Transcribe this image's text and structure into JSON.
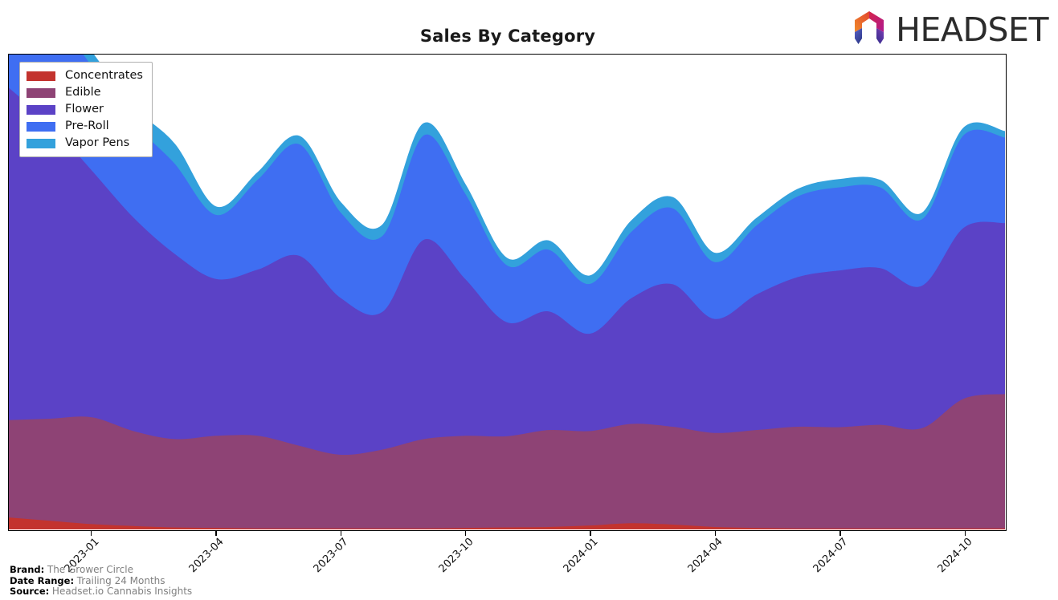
{
  "header": {
    "title": "Sales By Category",
    "logo_text": "HEADSET",
    "logo_icon": "headset-hexagon-logo"
  },
  "footer": {
    "rows": [
      {
        "key": "Brand:",
        "value": "The Grower Circle"
      },
      {
        "key": "Date Range:",
        "value": "Trailing 24 Months"
      },
      {
        "key": "Source:",
        "value": "Headset.io Cannabis Insights"
      }
    ]
  },
  "legend": {
    "position": "upper-left",
    "items": [
      {
        "label": "Concentrates",
        "color": "#C3332E"
      },
      {
        "label": "Edible",
        "color": "#8E4375"
      },
      {
        "label": "Flower",
        "color": "#5B42C6"
      },
      {
        "label": "Pre-Roll",
        "color": "#3F6EF2"
      },
      {
        "label": "Vapor Pens",
        "color": "#33A1DC"
      }
    ]
  },
  "chart_data": {
    "type": "area",
    "stacked": true,
    "title": "Sales By Category",
    "xlabel": "",
    "ylabel": "",
    "grid": false,
    "legend_position": "upper-left",
    "axis": {
      "x_tick_labels": [
        "2023-01",
        "2023-04",
        "2023-07",
        "2023-10",
        "2024-01",
        "2024-04",
        "2024-07",
        "2024-10"
      ],
      "x_tick_rotation": -45,
      "y_ticks_visible": false,
      "ylim": [
        0,
        100
      ]
    },
    "x": [
      "2022-11",
      "2022-12",
      "2023-01",
      "2023-02",
      "2023-03",
      "2023-04",
      "2023-05",
      "2023-06",
      "2023-07",
      "2023-08",
      "2023-09",
      "2023-10",
      "2023-11",
      "2023-12",
      "2024-01",
      "2024-02",
      "2024-03",
      "2024-04",
      "2024-05",
      "2024-06",
      "2024-07",
      "2024-08",
      "2024-09",
      "2024-10",
      "2024-11"
    ],
    "series": [
      {
        "name": "Concentrates",
        "color": "#C3332E",
        "values": [
          2.6,
          1.9,
          1.2,
          0.8,
          0.5,
          0.4,
          0.3,
          0.3,
          0.3,
          0.3,
          0.3,
          0.4,
          0.5,
          0.6,
          0.9,
          1.4,
          1.1,
          0.6,
          0.4,
          0.3,
          0.3,
          0.3,
          0.3,
          0.3,
          0.3
        ]
      },
      {
        "name": "Edible",
        "color": "#8E4375",
        "values": [
          20.5,
          21.5,
          22.5,
          20.0,
          18.6,
          19.4,
          19.5,
          17.4,
          15.5,
          16.6,
          18.8,
          19.4,
          19.2,
          20.4,
          19.9,
          20.9,
          20.6,
          19.8,
          20.6,
          21.4,
          21.3,
          21.8,
          21.1,
          27.3,
          28.3
        ]
      },
      {
        "name": "Flower",
        "color": "#5B42C6",
        "values": [
          70.0,
          62.0,
          52.0,
          45.0,
          39.0,
          33.0,
          35.0,
          40.0,
          33.0,
          29.0,
          42.0,
          33.0,
          24.0,
          25.0,
          20.5,
          26.5,
          30.0,
          24.0,
          28.5,
          31.5,
          33.0,
          33.0,
          30.0,
          36.0,
          36.0
        ]
      },
      {
        "name": "Pre-Roll",
        "color": "#3F6EF2",
        "values": [
          26.0,
          24.0,
          22.0,
          20.0,
          19.0,
          13.5,
          19.0,
          23.5,
          18.0,
          16.0,
          22.0,
          18.0,
          12.0,
          13.0,
          10.5,
          14.0,
          16.0,
          12.0,
          14.5,
          17.0,
          17.5,
          17.0,
          14.0,
          19.5,
          18.0
        ]
      },
      {
        "name": "Vapor Pens",
        "color": "#33A1DC",
        "values": [
          4.0,
          3.2,
          2.8,
          3.2,
          4.0,
          1.6,
          1.4,
          1.6,
          2.0,
          2.2,
          2.4,
          1.8,
          1.4,
          1.8,
          1.6,
          2.2,
          2.2,
          1.8,
          1.4,
          1.4,
          1.6,
          1.4,
          1.2,
          1.4,
          1.2
        ]
      }
    ]
  }
}
